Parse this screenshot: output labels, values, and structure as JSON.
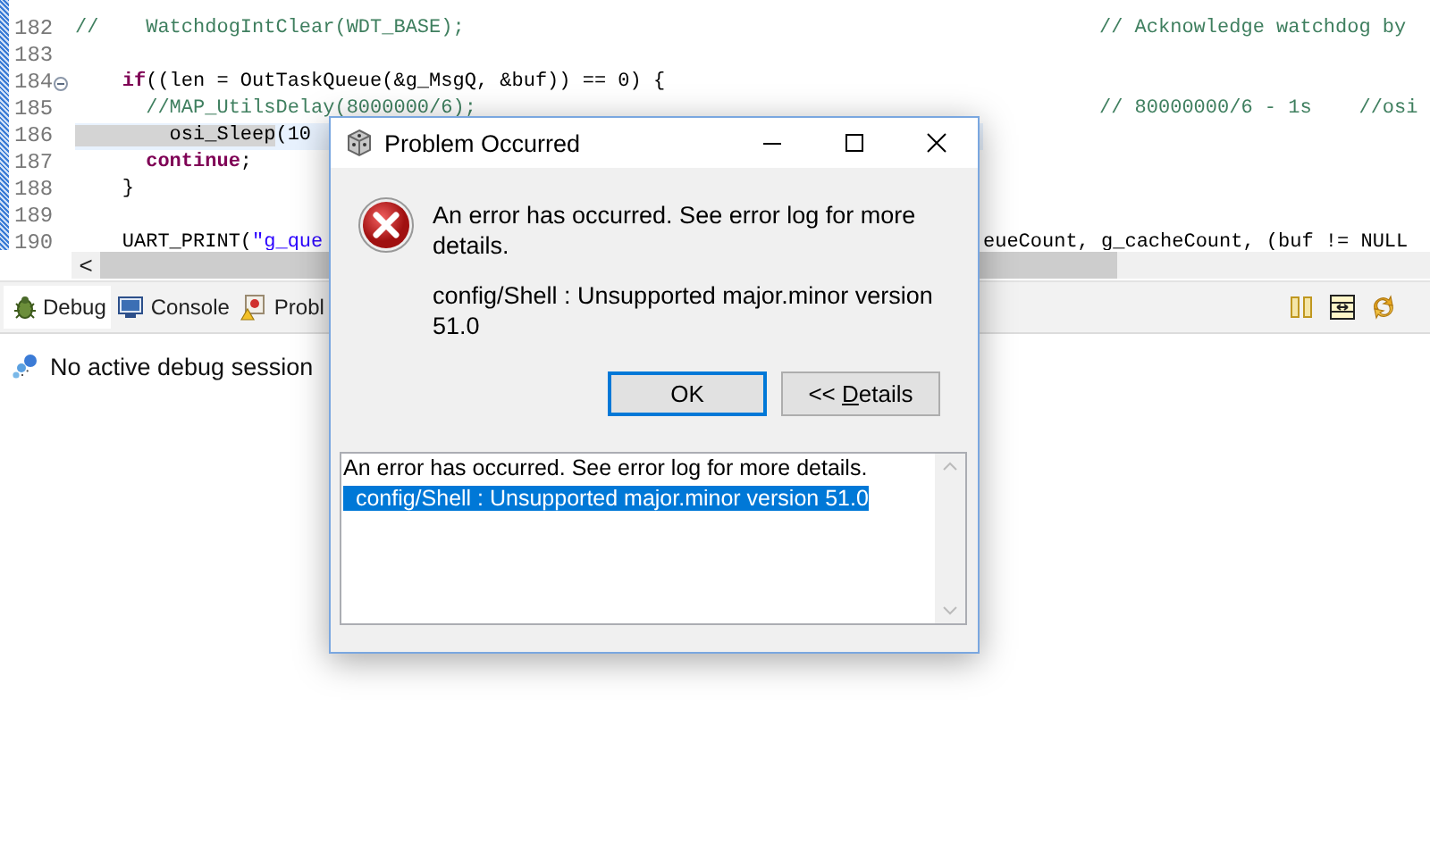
{
  "editor": {
    "lines": [
      {
        "number": "182",
        "current": false,
        "segments": [
          {
            "kind": "comment",
            "text": "//    WatchdogIntClear(WDT_BASE);"
          }
        ],
        "trailing": {
          "kind": "comment",
          "text": "// Acknowledge watchdog by"
        }
      },
      {
        "number": "183",
        "current": false
      },
      {
        "number": "184",
        "current": false,
        "fold": true,
        "segments": [
          {
            "kind": "keyword",
            "text": "    if"
          },
          {
            "kind": "plain",
            "text": "((len = OutTaskQueue(&g_MsgQ, &buf)) == 0) {"
          }
        ]
      },
      {
        "number": "185",
        "current": false,
        "segments": [
          {
            "kind": "comment",
            "text": "      //MAP_UtilsDelay(8000000/6);"
          }
        ],
        "trailing": {
          "kind": "comment",
          "text": "// 80000000/6 - 1s    //osi"
        }
      },
      {
        "number": "186",
        "current": true,
        "segments": [
          {
            "kind": "marked",
            "text": "        osi_Sleep"
          },
          {
            "kind": "plain",
            "text": "(10"
          }
        ]
      },
      {
        "number": "187",
        "current": false,
        "segments": [
          {
            "kind": "keyword",
            "text": "      continue"
          },
          {
            "kind": "plain",
            "text": ";"
          }
        ]
      },
      {
        "number": "188",
        "current": false,
        "segments": [
          {
            "kind": "plain",
            "text": "    }"
          }
        ]
      },
      {
        "number": "189",
        "current": false
      },
      {
        "number": "190",
        "current": false,
        "segments": [
          {
            "kind": "plain",
            "text": "    UART_PRINT("
          },
          {
            "kind": "string",
            "text": "\"g_que"
          }
        ],
        "continuation": "eueCount, g_cacheCount, (buf != NULL"
      }
    ],
    "scroll_left": "<"
  },
  "panel": {
    "tabs": [
      {
        "label": "Debug",
        "selected": true
      },
      {
        "label": "Console",
        "selected": false
      },
      {
        "label": "Probl",
        "selected": false
      }
    ],
    "message": "No active debug session"
  },
  "dialog": {
    "title": "Problem Occurred",
    "message": "An error has occurred. See error log for more details.",
    "reason": "config/Shell : Unsupported major.minor version 51.0",
    "buttons": [
      {
        "label": "OK",
        "default": true,
        "mnemonic": false
      },
      {
        "label": "<< Details",
        "default": false,
        "mnemonic": true
      }
    ],
    "details": [
      {
        "text": "An error has occurred. See error log for more details.",
        "selected": false
      },
      {
        "text": "  config/Shell : Unsupported major.minor version 51.0",
        "selected": true
      }
    ]
  }
}
